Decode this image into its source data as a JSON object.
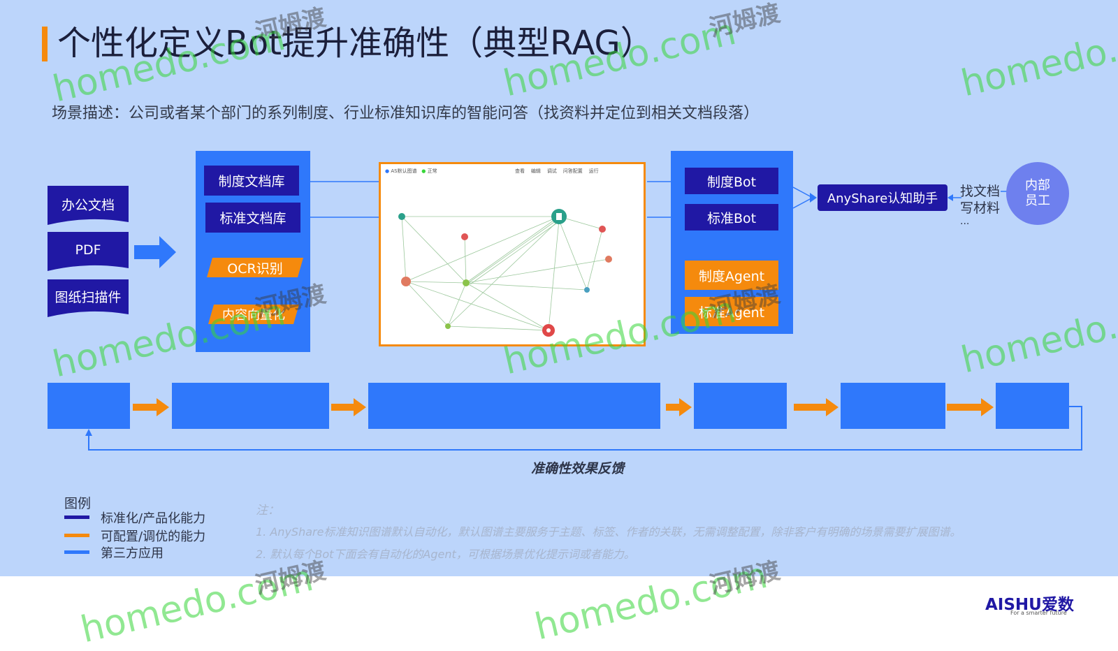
{
  "title": "个性化定义Bot提升准确性（典型RAG）",
  "subtitle": "场景描述：公司或者某个部门的系列制度、行业标准知识库的智能问答（找资料并定位到相关文档段落）",
  "sources": [
    "办公文档",
    "PDF",
    "图纸扫描件"
  ],
  "library_panel": {
    "items": [
      "制度文档库",
      "标准文档库"
    ],
    "configurable": [
      "OCR识别",
      "内容向量化"
    ]
  },
  "graph_toolbar": {
    "left": [
      "AS默认图谱",
      "正常"
    ],
    "right": [
      "查看",
      "编辑",
      "调试",
      "问答配置",
      "运行"
    ]
  },
  "bot_panel": {
    "items": [
      "制度Bot",
      "标准Bot"
    ],
    "configurable": [
      "制度Agent",
      "标准Agent"
    ]
  },
  "assistant": "AnyShare认知助手",
  "uses": [
    "找文档",
    "写材料",
    "..."
  ],
  "user_circle": [
    "内部",
    "员工"
  ],
  "feedback_label": "准确性效果反馈",
  "legend": {
    "title": "图例",
    "items": [
      {
        "label": "标准化/产品化能力",
        "color": "#2018a4"
      },
      {
        "label": "可配置/调优的能力",
        "color": "#f58a0d"
      },
      {
        "label": "第三方应用",
        "color": "#2f78fb"
      }
    ]
  },
  "notes": {
    "title": "注：",
    "lines": [
      "1. AnyShare标准知识图谱默认自动化，默认图谱主要服务于主题、标签、作者的关联，无需调整配置，除非客户有明确的场景需要扩展图谱。",
      "2. 默认每个Bot下面会有自动化的Agent，可根据场景优化提示词或者能力。"
    ]
  },
  "logo": {
    "brand": "AISHU爱数",
    "tagline": "For a smarter future"
  },
  "watermark": {
    "latin": "homedo.com",
    "cn": "河姆渡"
  },
  "colors": {
    "navy": "#2018a4",
    "orange": "#f58a0d",
    "blue": "#2f78fb",
    "background": "#bcd5fb",
    "graph_border": "#f58a0d"
  }
}
